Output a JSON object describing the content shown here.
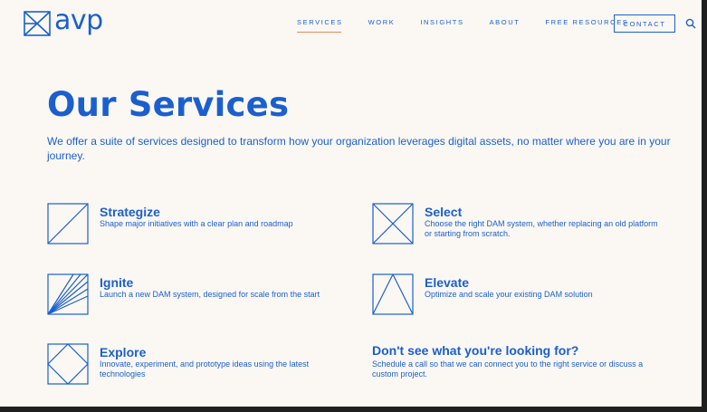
{
  "brand": {
    "name": "avp",
    "color": "#1b5fcf",
    "accent": "#e08a5a"
  },
  "nav": {
    "items": [
      {
        "label": "SERVICES",
        "active": true
      },
      {
        "label": "WORK"
      },
      {
        "label": "INSIGHTS"
      },
      {
        "label": "ABOUT"
      },
      {
        "label": "FREE RESOURCES"
      }
    ],
    "contact_label": "CONTACT",
    "search_icon": "search-icon"
  },
  "main": {
    "title": "Our Services",
    "intro": "We offer a suite of services designed to transform how your organization leverages digital assets, no matter where you are in your journey."
  },
  "services": [
    {
      "title": "Strategize",
      "description": "Shape major initiatives with a clear plan and roadmap",
      "icon": "strategize-icon"
    },
    {
      "title": "Select",
      "description": "Choose the right DAM system, whether replacing an old platform or starting from scratch.",
      "icon": "select-icon"
    },
    {
      "title": "Ignite",
      "description": "Launch a new DAM system, designed for scale from the start",
      "icon": "ignite-icon"
    },
    {
      "title": "Elevate",
      "description": "Optimize and scale your existing DAM solution",
      "icon": "elevate-icon"
    },
    {
      "title": "Explore",
      "description": "Innovate, experiment, and prototype ideas using the latest technologies",
      "icon": "explore-icon"
    }
  ],
  "cta": {
    "title": "Don't see what you're looking for?",
    "description": "Schedule a call so that we can connect you to the right service or discuss a custom project."
  }
}
